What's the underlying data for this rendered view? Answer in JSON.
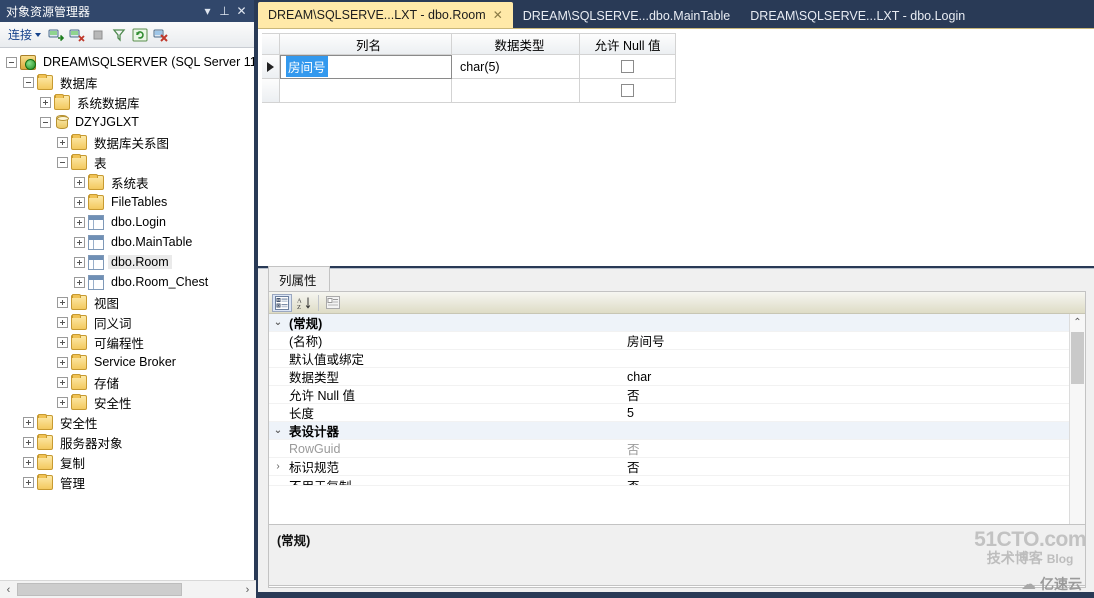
{
  "explorer": {
    "title": "对象资源管理器",
    "titlebar_buttons": [
      {
        "name": "dropdown-icon",
        "glyph": "▾"
      },
      {
        "name": "pin-icon",
        "glyph": "⊥"
      },
      {
        "name": "close-icon",
        "glyph": "✕"
      }
    ],
    "toolbar": {
      "connect_label": "连接",
      "buttons": [
        "connect-icon",
        "disconnect-icon",
        "stop-icon",
        "filter-icon",
        "refresh-icon",
        "remove-icon"
      ]
    },
    "tree": [
      {
        "label": "DREAM\\SQLSERVER (SQL Server 11",
        "indent": 0,
        "expander": "minus",
        "icon": "server",
        "selected": false
      },
      {
        "label": "数据库",
        "indent": 1,
        "expander": "minus",
        "icon": "folder",
        "selected": false
      },
      {
        "label": "系统数据库",
        "indent": 2,
        "expander": "plus",
        "icon": "folder",
        "selected": false
      },
      {
        "label": "DZYJGLXT",
        "indent": 2,
        "expander": "minus",
        "icon": "db",
        "selected": false
      },
      {
        "label": "数据库关系图",
        "indent": 3,
        "expander": "plus",
        "icon": "folder",
        "selected": false
      },
      {
        "label": "表",
        "indent": 3,
        "expander": "minus",
        "icon": "folder",
        "selected": false
      },
      {
        "label": "系统表",
        "indent": 4,
        "expander": "plus",
        "icon": "folder",
        "selected": false
      },
      {
        "label": "FileTables",
        "indent": 4,
        "expander": "plus",
        "icon": "folder",
        "selected": false
      },
      {
        "label": "dbo.Login",
        "indent": 4,
        "expander": "plus",
        "icon": "table",
        "selected": false
      },
      {
        "label": "dbo.MainTable",
        "indent": 4,
        "expander": "plus",
        "icon": "table",
        "selected": false
      },
      {
        "label": "dbo.Room",
        "indent": 4,
        "expander": "plus",
        "icon": "table",
        "selected": true
      },
      {
        "label": "dbo.Room_Chest",
        "indent": 4,
        "expander": "plus",
        "icon": "table",
        "selected": false
      },
      {
        "label": "视图",
        "indent": 3,
        "expander": "plus",
        "icon": "folder",
        "selected": false
      },
      {
        "label": "同义词",
        "indent": 3,
        "expander": "plus",
        "icon": "folder",
        "selected": false
      },
      {
        "label": "可编程性",
        "indent": 3,
        "expander": "plus",
        "icon": "folder",
        "selected": false
      },
      {
        "label": "Service Broker",
        "indent": 3,
        "expander": "plus",
        "icon": "folder",
        "selected": false
      },
      {
        "label": "存储",
        "indent": 3,
        "expander": "plus",
        "icon": "folder",
        "selected": false
      },
      {
        "label": "安全性",
        "indent": 3,
        "expander": "plus",
        "icon": "folder",
        "selected": false
      },
      {
        "label": "安全性",
        "indent": 1,
        "expander": "plus",
        "icon": "folder",
        "selected": false
      },
      {
        "label": "服务器对象",
        "indent": 1,
        "expander": "plus",
        "icon": "folder",
        "selected": false
      },
      {
        "label": "复制",
        "indent": 1,
        "expander": "plus",
        "icon": "folder",
        "selected": false
      },
      {
        "label": "管理",
        "indent": 1,
        "expander": "plus",
        "icon": "folder",
        "selected": false
      }
    ],
    "hscroll": {
      "left_arrow": "‹",
      "right_arrow": "›"
    }
  },
  "tabs": [
    {
      "label": "DREAM\\SQLSERVE...LXT - dbo.Room",
      "active": true,
      "close": "✕"
    },
    {
      "label": "DREAM\\SQLSERVE...dbo.MainTable",
      "active": false
    },
    {
      "label": "DREAM\\SQLSERVE...LXT - dbo.Login",
      "active": false
    }
  ],
  "tab_overflow_icon": "▾",
  "designer": {
    "headers": [
      "列名",
      "数据类型",
      "允许 Null 值"
    ],
    "rows": [
      {
        "marker": true,
        "name": "房间号",
        "name_selected": true,
        "type": "char(5)",
        "allow_null": false
      },
      {
        "marker": false,
        "name": "",
        "name_selected": false,
        "type": "",
        "allow_null": false
      }
    ]
  },
  "properties": {
    "tab_label": "列属性",
    "toolbar": [
      {
        "name": "categorized-icon",
        "glyph": "▤",
        "active": true
      },
      {
        "name": "alphabetical-sort-icon",
        "glyph": "A↓",
        "active": false
      },
      {
        "name": "property-pages-icon",
        "glyph": "▥",
        "active": false
      }
    ],
    "rows": [
      {
        "kind": "category",
        "expander": "v",
        "key": "(常规)",
        "value": "",
        "dim": false
      },
      {
        "kind": "prop",
        "expander": "",
        "key": "(名称)",
        "value": "房间号",
        "dim": false
      },
      {
        "kind": "prop",
        "expander": "",
        "key": "默认值或绑定",
        "value": "",
        "dim": false
      },
      {
        "kind": "prop",
        "expander": "",
        "key": "数据类型",
        "value": "char",
        "dim": false
      },
      {
        "kind": "prop",
        "expander": "",
        "key": "允许 Null 值",
        "value": "否",
        "dim": false
      },
      {
        "kind": "prop",
        "expander": "",
        "key": "长度",
        "value": "5",
        "dim": false
      },
      {
        "kind": "category",
        "expander": "v",
        "key": "表设计器",
        "value": "",
        "dim": false
      },
      {
        "kind": "prop",
        "expander": "",
        "key": "RowGuid",
        "value": "否",
        "dim": true
      },
      {
        "kind": "prop",
        "expander": ">",
        "key": "标识规范",
        "value": "否",
        "dim": false
      },
      {
        "kind": "prop",
        "expander": "",
        "key": "不用于复制",
        "value": "否",
        "dim": false,
        "clipped": true
      }
    ],
    "description": "(常规)",
    "scroll_up_icon": "⌃",
    "scroll_down_icon": "⌄"
  },
  "watermarks": {
    "primary_main": "51CTO.com",
    "primary_sub": "技术博客",
    "primary_blog": "Blog",
    "secondary": "亿速云",
    "secondary_icon": "☁"
  },
  "colors": {
    "chrome": "#293a56",
    "active_tab": "#ffe9a8",
    "selection": "#3399ee",
    "folder": "#f3c95f"
  }
}
